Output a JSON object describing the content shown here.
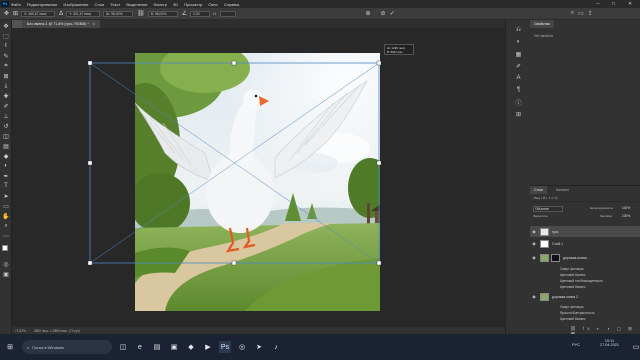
{
  "menu": {
    "logo": "Ps",
    "items": [
      "Файл",
      "Редактирование",
      "Изображение",
      "Слои",
      "Текст",
      "Выделение",
      "Фильтр",
      "3D",
      "Просмотр",
      "Окно",
      "Справка"
    ],
    "win_minimize": "─",
    "win_maximize": "□",
    "win_close": "✕"
  },
  "options": {
    "x_value": "X: 460,57 пикс",
    "y_value": "Y: 401,47 пикс",
    "w_value": "Ш: 96,00%",
    "h_value": "В: 96,00%",
    "angle_value": "0,00",
    "interp_label": "Н:",
    "cancel_icon": "cancel-icon",
    "commit_icon": "check-icon"
  },
  "doc_tab": {
    "title": "Без имени-1 @ 71,8% (гусь, RGB/8) *"
  },
  "transform_readout": {
    "w_line": "Ш: 1229 пикс.",
    "h_line": "В: 866 пикс."
  },
  "status": {
    "zoom": "71,82%",
    "doc_size": "2880 пикс. x 2880 пикс. (72 ppi)"
  },
  "panels": {
    "properties_tab": "Свойства",
    "properties_sub": "Нет свойств",
    "layers_tab": "Слои",
    "channels_tab": "Каналы",
    "blend_mode": "Обычные",
    "opacity_label": "Непрозрачность:",
    "opacity_value": "100%",
    "fill_label": "Заливка:",
    "fill_value": "100%",
    "lock_label": "Закрепить:"
  },
  "layers": [
    {
      "name": "гусь",
      "selected": true
    },
    {
      "name": "Слой 1",
      "selected": false
    },
    {
      "name": "дорожка-копия...",
      "selected": false
    },
    {
      "name": "дорожка копия 2",
      "selected": false
    }
  ],
  "effects_group1": [
    "Смарт-фильтры",
    "Цветовой баланс",
    "Цветовой тон/Насыщенность",
    "Цветовой баланс"
  ],
  "effects_group2": [
    "Смарт-фильтры",
    "Яркость/Контрастность",
    "Цветовой баланс"
  ],
  "taskbar": {
    "search_placeholder": "Поиск в Windows",
    "time": "19:11",
    "date": "27.04.2021",
    "lang": "РУС"
  }
}
